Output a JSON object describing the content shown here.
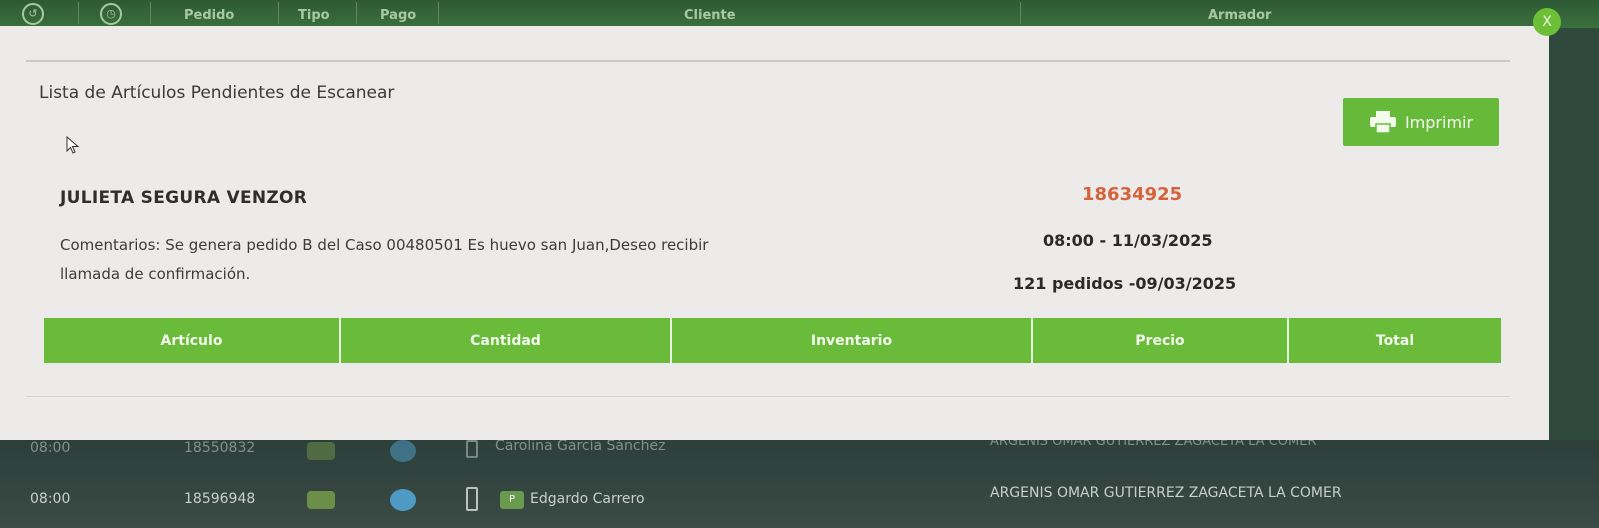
{
  "background": {
    "header_columns": [
      "Pedido",
      "Tipo",
      "Pago",
      "Cliente",
      "Armador"
    ],
    "rows": [
      {
        "time": "08:00",
        "order": "18550832",
        "client": "Carolina García Sánchez",
        "assembler": "ARGENIS OMAR GUTIERREZ ZAGACETA LA COMER"
      },
      {
        "time": "08:00",
        "order": "18596948",
        "client": "Edgardo Carrero",
        "assembler": "ARGENIS OMAR GUTIERREZ ZAGACETA LA COMER"
      }
    ]
  },
  "modal": {
    "close_label": "X",
    "title": "Lista de Artículos Pendientes de Escanear",
    "print_label": "Imprimir",
    "customer_name": "JULIETA SEGURA VENZOR",
    "order_number": "18634925",
    "comments": "Comentarios: Se genera pedido B del Caso 00480501 Es huevo san Juan,Deseo recibir llamada de confirmación.",
    "schedule": "08:00 - 11/03/2025",
    "orders_count": "121 pedidos -09/03/2025",
    "table_headers": [
      "Artículo",
      "Cantidad",
      "Inventario",
      "Precio",
      "Total"
    ]
  },
  "colors": {
    "accent_green": "#6bbb3a",
    "order_number": "#d4633c"
  }
}
